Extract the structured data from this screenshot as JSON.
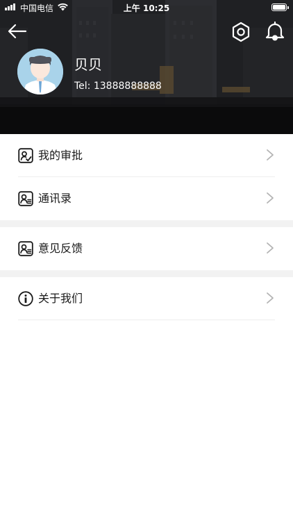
{
  "status_bar": {
    "carrier": "中国电信",
    "time": "上午 10:25"
  },
  "header": {
    "back_icon": "arrow-left-icon",
    "settings_icon": "hexagon-settings-icon",
    "notification_icon": "bell-icon"
  },
  "profile": {
    "name": "贝贝",
    "tel": "Tel:  13888888888",
    "avatar_icon": "avatar-icon"
  },
  "menu": {
    "items": [
      {
        "label": "我的审批",
        "icon": "approval-icon"
      },
      {
        "label": "通讯录",
        "icon": "contacts-icon"
      },
      {
        "label": "意见反馈",
        "icon": "feedback-icon"
      },
      {
        "label": "关于我们",
        "icon": "info-icon"
      }
    ]
  },
  "colors": {
    "header_bg": "#1d1e20",
    "section_gap": "#f2f2f2",
    "chevron": "#b3b3b3",
    "text": "#1a1a1a"
  }
}
